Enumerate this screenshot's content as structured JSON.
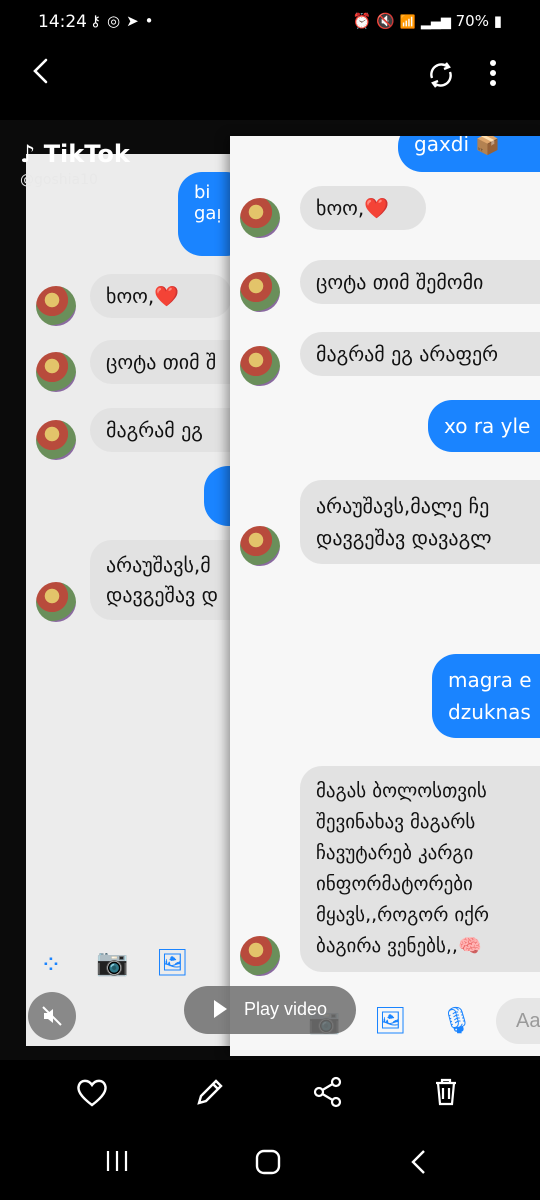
{
  "status": {
    "time": "14:24",
    "left_icons": [
      "key-icon",
      "instagram-icon",
      "telegram-icon",
      "dot-icon"
    ],
    "right_icons": [
      "alarm-icon",
      "mute-icon",
      "wifi-icon",
      "signal-icon"
    ],
    "network": "Vo)\nLTE1",
    "battery": "70%"
  },
  "tiktok": {
    "logo": "TikTok",
    "user": "@goshia10"
  },
  "chat_left": {
    "out_top": "bi\ngaᴉ",
    "messages": [
      "ხოო,❤️",
      "ცოტა თიმ შ",
      "მაგრამ ეგ ",
      "არაუშავს,მ\nდავგეშავ დ"
    ]
  },
  "chat_right": {
    "out_top": "gaxdi 📦",
    "in1": "ხოო,❤️",
    "in2": "ცოტა თიმ შემომი",
    "in3": "მაგრამ ეგ არაფერ",
    "out1": "xo ra yle",
    "in4_l1": "არაუშავს,მალე ჩე",
    "in4_l2": "დავგეშავ დავაგლ",
    "out2_l1": "magra e",
    "out2_l2": "dzuknas",
    "in5": [
      "მაგას ბოლოსთვის",
      "შევინახავ მაგარს",
      "ჩავუტარებ კარგი",
      "ინფორმატორები",
      "მყავს,,როგორ იქრ",
      "ბაგირა ვენებს,,🧠"
    ],
    "composer_placeholder": "Aa"
  },
  "player": {
    "play_label": "Play video"
  },
  "colors": {
    "messenger_blue": "#1a84ff",
    "bubble_gray": "#e2e2e2"
  }
}
